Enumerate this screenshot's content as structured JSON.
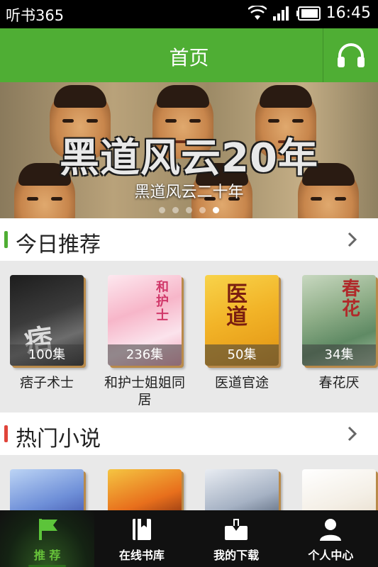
{
  "status_bar": {
    "app_name": "听书365",
    "time": "16:45"
  },
  "header": {
    "title": "首页",
    "listen_icon": "headphones-icon"
  },
  "banner": {
    "overlay_title": "黑道风云20年",
    "caption": "黑道风云二十年",
    "dots_total": 5,
    "active_dot_index": 4
  },
  "sections": [
    {
      "title": "今日推荐",
      "accent": "#4fae34",
      "books": [
        {
          "title": "痞子术士",
          "count": "100集"
        },
        {
          "title": "和护士姐姐同居",
          "count": "236集"
        },
        {
          "title": "医道官途",
          "count": "50集"
        },
        {
          "title": "春花厌",
          "count": "34集"
        }
      ]
    },
    {
      "title": "热门小说",
      "accent": "#e0443a",
      "books": [
        {
          "title": "",
          "count": ""
        },
        {
          "title": "",
          "count": ""
        },
        {
          "title": "",
          "count": ""
        },
        {
          "title": "",
          "count": ""
        }
      ]
    }
  ],
  "bottom_nav": {
    "items": [
      {
        "label": "推 荐",
        "icon": "flag-icon",
        "active": true
      },
      {
        "label": "在线书库",
        "icon": "bookmark-book-icon",
        "active": false
      },
      {
        "label": "我的下载",
        "icon": "download-box-icon",
        "active": false
      },
      {
        "label": "个人中心",
        "icon": "user-icon",
        "active": false
      }
    ]
  },
  "colors": {
    "primary_green": "#4fae34",
    "status_bar_bg": "#000000",
    "nav_bg": "#111111"
  }
}
